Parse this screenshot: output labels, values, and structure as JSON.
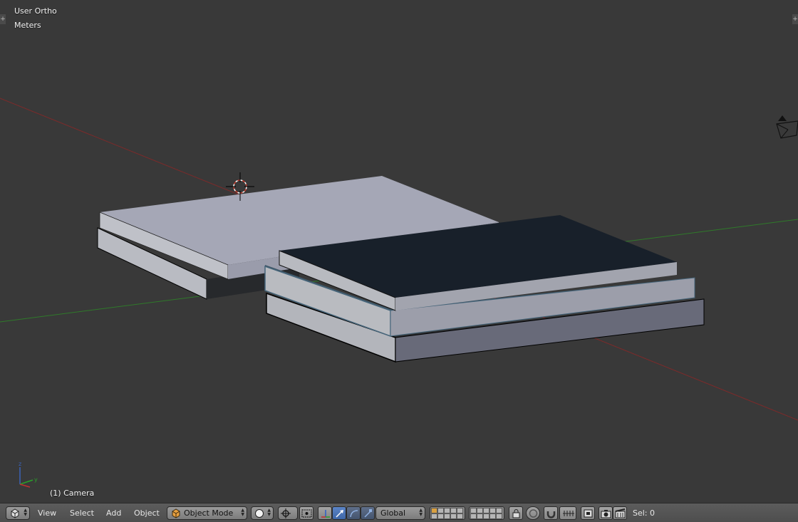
{
  "viewport": {
    "view_name": "User Ortho",
    "units": "Meters",
    "active_object_label": "(1) Camera",
    "axis_colors": {
      "x": "#8a2a2a",
      "y": "#3a8a2a"
    }
  },
  "header": {
    "editor_type_icon": "3d-view-cube-icon",
    "menus": [
      "View",
      "Select",
      "Add",
      "Object"
    ],
    "mode": "Object Mode",
    "mode_icon": "object-mode-cube-icon",
    "shading_icon": "solid-sphere-icon",
    "pivot_icon": "pivot-point-icon",
    "manipulator_icons": [
      "manipulator-toggle-icon",
      "translate-icon",
      "rotate-icon",
      "scale-icon"
    ],
    "orientation": "Global",
    "layers_icon": "layers-grid-icon",
    "lock_icon": "lock-layer-icon",
    "proportional_icon": "proportional-edit-icon",
    "snap_icon": "snap-magnet-icon",
    "snap_element_icon": "snap-increment-icon",
    "snap_target_icon": "snap-target-icon",
    "render_icon": "opengl-render-icon",
    "anim_render_icon": "opengl-anim-render-icon",
    "selection_status": "Sel: 0"
  }
}
